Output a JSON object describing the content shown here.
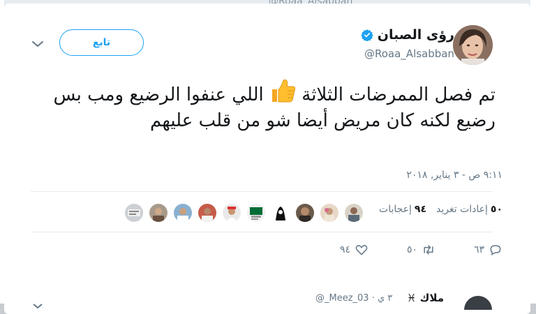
{
  "background": {
    "top_handle": "@Roaa_Alsabban"
  },
  "tweet": {
    "author": {
      "display_name": "رؤى الصبان",
      "handle": "@Roaa_Alsabban",
      "verified": true,
      "avatar_icon": "avatar-photo"
    },
    "follow_label": "تابع",
    "text_part1": "تم فصل الممرضات الثلاثة",
    "text_emoji_icon": "thumbs-up-icon",
    "text_part2": "اللي عنفوا الرضيع ومب بس رضيع لكنه كان مريض أيضا شو من قلب عليهم",
    "timestamp": "٩:١١ ص - ٣ يناير, ٢٠١٨",
    "stats": {
      "retweets_count": "٥٠",
      "retweets_label": "إعادات تغريد",
      "likes_count": "٩٤",
      "likes_label": "إعجابات"
    },
    "actions": {
      "replies": "٦٣",
      "retweets": "٥٠",
      "likes": "٩٤"
    }
  },
  "next_tweet": {
    "name": "ملاك ♓",
    "handle": "@_Meez_03 · ٣ ي"
  },
  "colors": {
    "accent": "#1da1f2",
    "text_primary": "#14171a",
    "text_secondary": "#657786",
    "divider": "#e6ecf0",
    "thumb": "#ffbe2e"
  }
}
